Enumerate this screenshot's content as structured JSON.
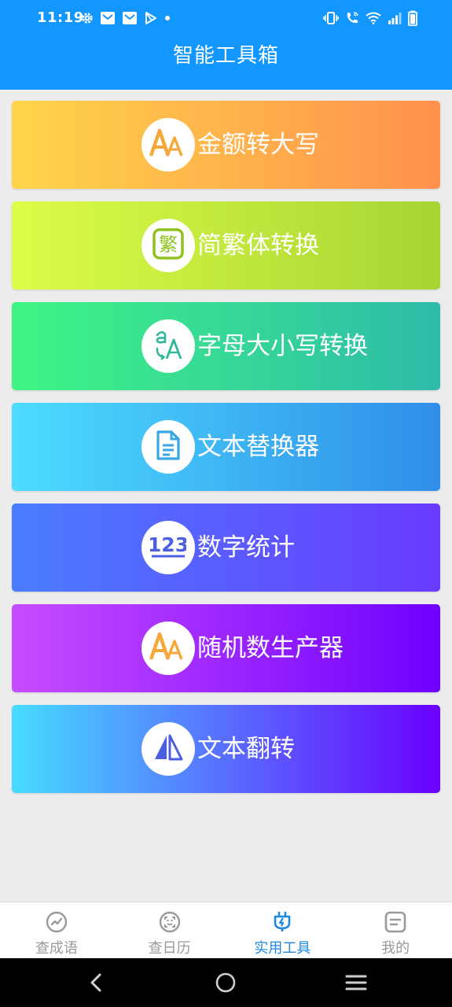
{
  "status_bar": {
    "time": "11:19",
    "left_icons": [
      "gear-icon",
      "mail-icon",
      "mail-icon",
      "play-store-icon",
      "dot-icon"
    ],
    "right_icons": [
      "vibrate-icon",
      "wifi-call-icon",
      "wifi-icon",
      "signal-icon",
      "battery-icon"
    ]
  },
  "header": {
    "title": "智能工具箱",
    "background": "#1296ff"
  },
  "tools": [
    {
      "label": "金额转大写",
      "icon": "letter-aa-icon",
      "gradient": [
        "#ffd54a",
        "#ff914d"
      ],
      "icon_color": "#f4a93a"
    },
    {
      "label": "简繁体转换",
      "icon": "traditional-char-icon",
      "gradient": [
        "#dcfd48",
        "#a8d433"
      ],
      "icon_color": "#8fc21f"
    },
    {
      "label": "字母大小写转换",
      "icon": "letter-case-icon",
      "gradient": [
        "#3ff584",
        "#2ebba9"
      ],
      "icon_color": "#2fb79a"
    },
    {
      "label": "文本替换器",
      "icon": "document-icon",
      "gradient": [
        "#4ddcff",
        "#2f8ee8"
      ],
      "icon_color": "#3aa6e6"
    },
    {
      "label": "数字统计",
      "icon": "number-123-icon",
      "gradient": [
        "#4a7dff",
        "#6a3bff"
      ],
      "icon_color": "#4b5fe0"
    },
    {
      "label": "随机数生产器",
      "icon": "letter-aa-icon",
      "gradient": [
        "#c84cff",
        "#6f00ff"
      ],
      "icon_color": "#f4a93a"
    },
    {
      "label": "文本翻转",
      "icon": "flip-icon",
      "gradient": [
        "#46dcff",
        "#6a00ff"
      ],
      "icon_color": "#4b5fe0"
    }
  ],
  "bottom_nav": [
    {
      "label": "查成语",
      "icon": "chart-circle-icon",
      "active": false
    },
    {
      "label": "查日历",
      "icon": "face-scan-icon",
      "active": false
    },
    {
      "label": "实用工具",
      "icon": "plug-icon",
      "active": true
    },
    {
      "label": "我的",
      "icon": "profile-card-icon",
      "active": false
    }
  ],
  "colors": {
    "active_nav": "#1e88e5",
    "inactive_nav": "#9a9a9a",
    "page_background": "#ececec"
  }
}
